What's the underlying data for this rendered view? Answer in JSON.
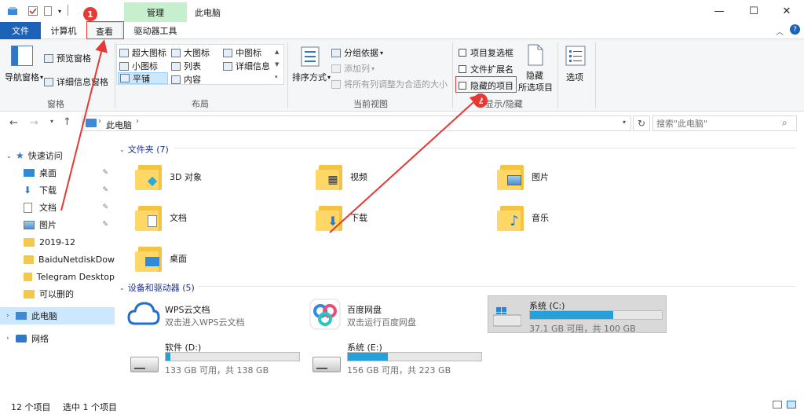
{
  "window": {
    "title": "此电脑",
    "context_tab": "管理",
    "minimize": "—",
    "maximize": "☐",
    "close": "✕"
  },
  "tabs": {
    "file": "文件",
    "computer": "计算机",
    "view": "查看",
    "drive_tools": "驱动器工具"
  },
  "ribbon": {
    "panes": {
      "nav_pane": "导航窗格",
      "preview_pane": "预览窗格",
      "details_pane": "详细信息窗格",
      "label": "窗格"
    },
    "layout": {
      "xlarge_icons": "超大图标",
      "large_icons": "大图标",
      "medium_icons": "中图标",
      "small_icons": "小图标",
      "list": "列表",
      "details": "详细信息",
      "tiles": "平铺",
      "content": "内容",
      "label": "布局"
    },
    "current_view": {
      "sort_by": "排序方式",
      "group_by": "分组依据",
      "add_columns": "添加列",
      "size_all_columns": "将所有列调整为合适的大小",
      "label": "当前视图"
    },
    "show_hide": {
      "item_checkboxes": "项目复选框",
      "file_name_extensions": "文件扩展名",
      "hidden_items": "隐藏的项目",
      "hide_selected_line1": "隐藏",
      "hide_selected_line2": "所选项目",
      "label": "显示/隐藏"
    },
    "options": "选项"
  },
  "address": {
    "path": "此电脑",
    "search_placeholder": "搜索\"此电脑\""
  },
  "sidebar": {
    "quick_access": "快速访问",
    "items": [
      {
        "label": "桌面",
        "pinned": true
      },
      {
        "label": "下载",
        "pinned": true
      },
      {
        "label": "文档",
        "pinned": true
      },
      {
        "label": "图片",
        "pinned": true
      },
      {
        "label": "2019-12",
        "pinned": false
      },
      {
        "label": "BaiduNetdiskDow",
        "pinned": false
      },
      {
        "label": "Telegram Desktop",
        "pinned": false
      },
      {
        "label": "可以删的",
        "pinned": false
      }
    ],
    "this_pc": "此电脑",
    "network": "网络"
  },
  "content": {
    "folders_header": "文件夹 (7)",
    "folders": [
      "3D 对象",
      "视频",
      "图片",
      "文档",
      "下载",
      "音乐",
      "桌面"
    ],
    "devices_header": "设备和驱动器 (5)",
    "devices": [
      {
        "name": "WPS云文档",
        "sub": "双击进入WPS云文档"
      },
      {
        "name": "百度网盘",
        "sub": "双击运行百度网盘"
      },
      {
        "name": "系统 (C:)",
        "sub": "37.1 GB 可用，共 100 GB",
        "used_fraction": 0.63
      },
      {
        "name": "软件 (D:)",
        "sub": "133 GB 可用，共 138 GB",
        "used_fraction": 0.036
      },
      {
        "name": "系统 (E:)",
        "sub": "156 GB 可用，共 223 GB",
        "used_fraction": 0.3
      }
    ]
  },
  "status": {
    "item_count": "12 个项目",
    "selected": "选中 1 个项目"
  },
  "annotations": {
    "step1": "1",
    "step2": "2"
  },
  "colors": {
    "file_tab": "#1c62b9",
    "context_tab": "#c6efce",
    "drive_bar": "#26a0da",
    "annotation": "#e53935",
    "selection": "#cce8ff"
  }
}
